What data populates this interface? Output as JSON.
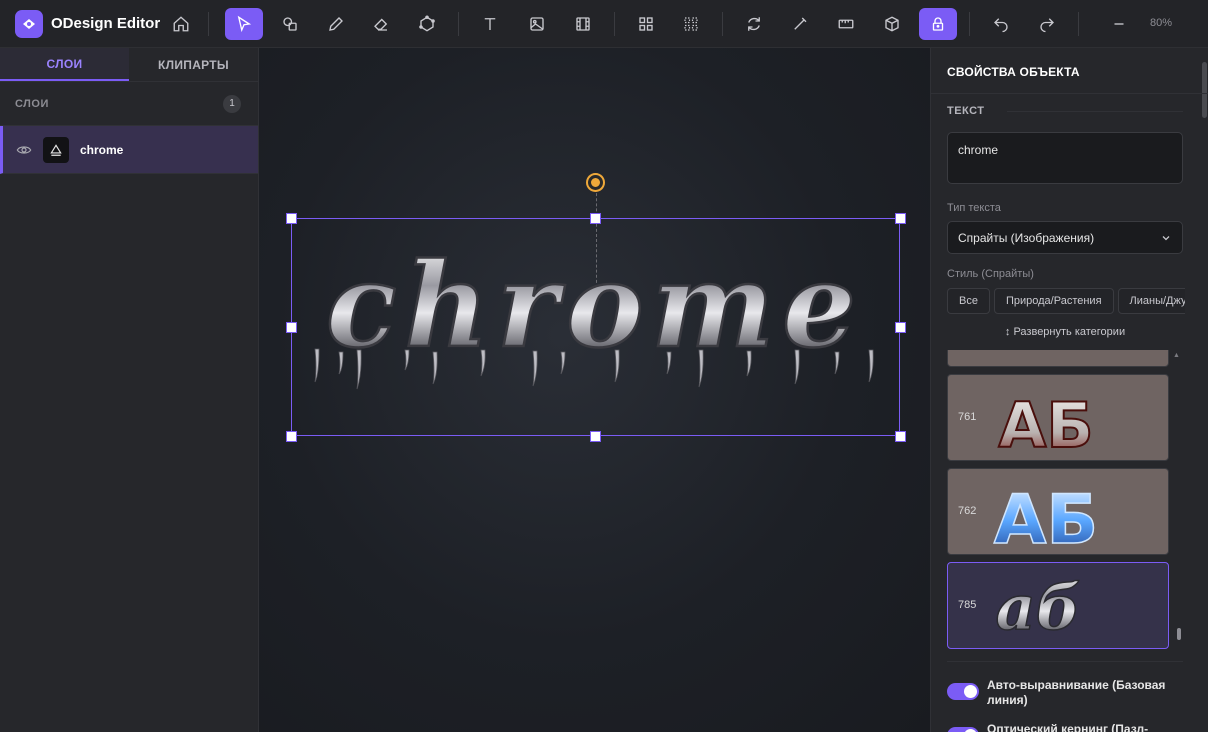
{
  "app": {
    "title": "ODesign Editor",
    "zoom": "80%"
  },
  "left_panel": {
    "tabs": [
      {
        "label": "СЛОИ",
        "active": true
      },
      {
        "label": "КЛИПАРТЫ",
        "active": false
      }
    ],
    "layers_title": "СЛОИ",
    "layers_count": "1",
    "layers": [
      {
        "name": "chrome"
      }
    ]
  },
  "canvas": {
    "text": "chrome"
  },
  "right_panel": {
    "title": "СВОЙСТВА ОБЪЕКТА",
    "section": "ТЕКСТ",
    "text_value": "chrome",
    "text_type_label": "Тип текста",
    "text_type_value": "Спрайты (Изображения)",
    "style_label": "Стиль (Спрайты)",
    "chips": [
      "Все",
      "Природа/Растения",
      "Лианы/Джунгли"
    ],
    "expand_label": "↕ Развернуть категории",
    "sprites": [
      {
        "num": "761",
        "letters": "АБ"
      },
      {
        "num": "762",
        "letters": "АБ"
      },
      {
        "num": "785",
        "letters": "аб"
      }
    ],
    "toggles": [
      {
        "label": "Авто-выравнивание (Базовая линия)",
        "on": true
      },
      {
        "label": "Оптический кернинг (Пазл-",
        "on": true
      }
    ]
  },
  "colors": {
    "accent": "#7b5cf5",
    "rotate_handle": "#f0a93a"
  }
}
